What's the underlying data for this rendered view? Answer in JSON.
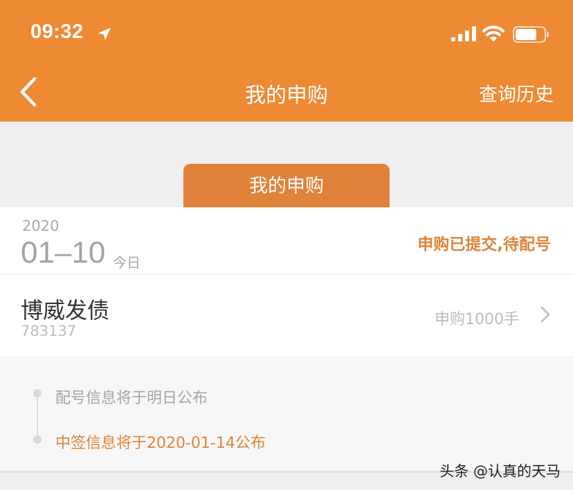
{
  "status_bar": {
    "time": "09:32"
  },
  "nav": {
    "title": "我的申购",
    "history_label": "查询历史"
  },
  "tabs": [
    {
      "label": "我的申购",
      "active": true
    }
  ],
  "record": {
    "year": "2020",
    "month_day": "01–10",
    "today_label": "今日",
    "status": "申购已提交,待配号",
    "stock": {
      "name": "博威发债",
      "code": "783137",
      "quantity": "申购1000手"
    },
    "timeline": [
      {
        "text": "配号信息将于明日公布",
        "highlight": false
      },
      {
        "text": "中签信息将于2020-01-14公布",
        "highlight": true
      }
    ]
  },
  "watermark": "头条 @认真的天马",
  "colors": {
    "brand": "#ef8a34",
    "tab": "#e0823a",
    "status_text": "#e0843a"
  }
}
